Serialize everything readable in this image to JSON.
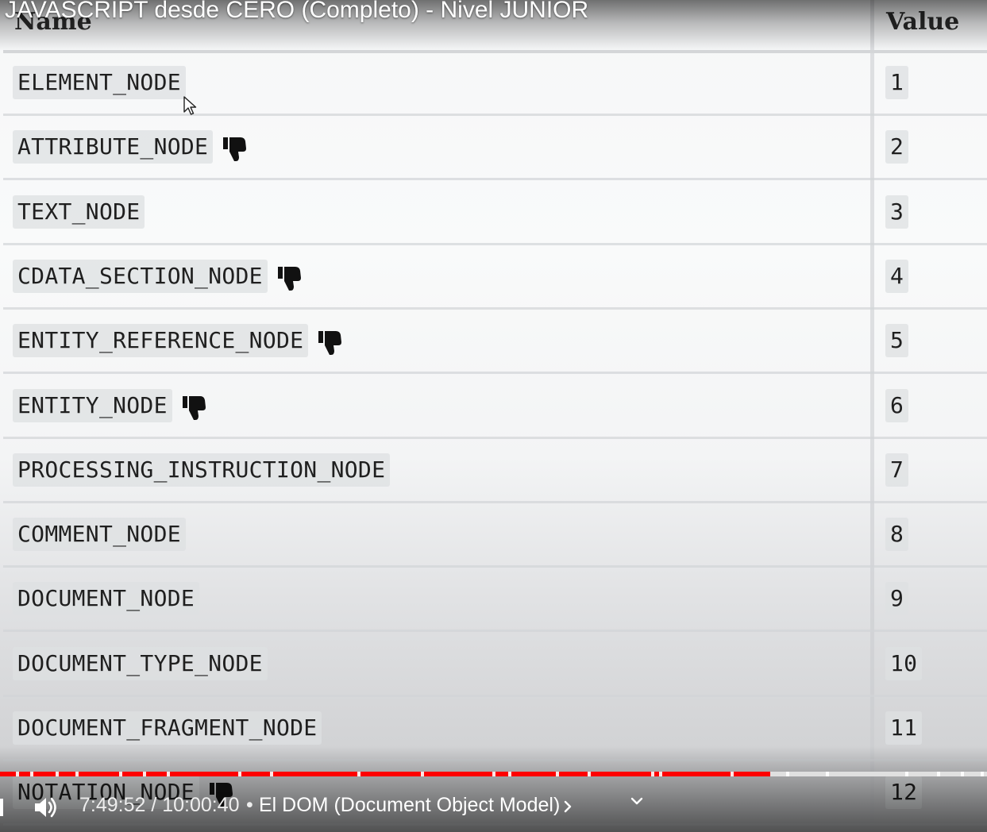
{
  "video": {
    "title": "JAVASCRIPT desde CERO (Completo) - Nivel JUNIOR"
  },
  "table": {
    "headers": {
      "name": "Name",
      "value": "Value"
    },
    "rows": [
      {
        "name": "ELEMENT_NODE",
        "value": "1",
        "deprecated": false
      },
      {
        "name": "ATTRIBUTE_NODE",
        "value": "2",
        "deprecated": true
      },
      {
        "name": "TEXT_NODE",
        "value": "3",
        "deprecated": false
      },
      {
        "name": "CDATA_SECTION_NODE",
        "value": "4",
        "deprecated": true
      },
      {
        "name": "ENTITY_REFERENCE_NODE",
        "value": "5",
        "deprecated": true
      },
      {
        "name": "ENTITY_NODE",
        "value": "6",
        "deprecated": true
      },
      {
        "name": "PROCESSING_INSTRUCTION_NODE",
        "value": "7",
        "deprecated": false
      },
      {
        "name": "COMMENT_NODE",
        "value": "8",
        "deprecated": false
      },
      {
        "name": "DOCUMENT_NODE",
        "value": "9",
        "deprecated": false
      },
      {
        "name": "DOCUMENT_TYPE_NODE",
        "value": "10",
        "deprecated": false
      },
      {
        "name": "DOCUMENT_FRAGMENT_NODE",
        "value": "11",
        "deprecated": false
      },
      {
        "name": "NOTATION_NODE",
        "value": "12",
        "deprecated": true
      }
    ],
    "deprecated_icon": "thumbs-down-icon"
  },
  "player": {
    "current_time": "7:49:52",
    "duration": "10:00:40",
    "time_display": "7:49:52 / 10:00:40",
    "separator": "•",
    "chapter": "El DOM (Document Object Model)",
    "progress_fraction": 0.78,
    "progress_color": "#ff0000",
    "icons": [
      "volume-icon",
      "chevron-right-icon",
      "chevron-down-icon"
    ]
  }
}
